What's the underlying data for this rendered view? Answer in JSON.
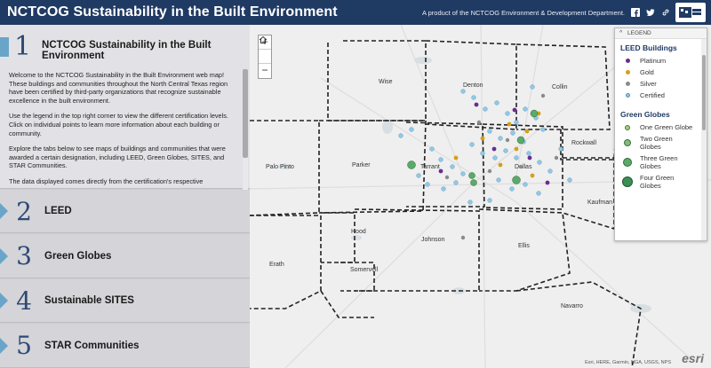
{
  "header": {
    "title": "NCTCOG Sustainability in the Built Environment",
    "product_text": "A product of the NCTCOG Environment & Development Department.",
    "social": [
      "facebook-icon",
      "twitter-icon",
      "link-icon"
    ],
    "bg_color": "#1f3a63"
  },
  "sections": [
    {
      "num": "1",
      "label": "NCTCOG Sustainability in the Built Environment"
    },
    {
      "num": "2",
      "label": "LEED"
    },
    {
      "num": "3",
      "label": "Green Globes"
    },
    {
      "num": "4",
      "label": "Sustainable SITES"
    },
    {
      "num": "5",
      "label": "STAR Communities"
    }
  ],
  "intro": {
    "p1": "Welcome to the NCTCOG Sustainability in the Built Environment web map! These buildings and communities throughout the North Central Texas region have been certified by third-party organizations that recognize sustainable excellence in the built environment.",
    "p2": "Use the legend in the top right corner to view the different certification levels. Click on individual points to learn more information about each building or community.",
    "p3": "Explore the tabs below to see maps of buildings and communities that were awarded a certain designation, including LEED, Green Globes, SITES, and STAR Communities.",
    "p4": "The data displayed comes directly from the certification's respective"
  },
  "map": {
    "zoom_in": "+",
    "zoom_out": "−",
    "counties": [
      "Wise",
      "Denton",
      "Collin",
      "Rockwall",
      "Parker",
      "Tarrant",
      "Dallas",
      "Palo Pinto",
      "Kaufman",
      "Hood",
      "Johnson",
      "Ellis",
      "Somervell",
      "Erath",
      "Navarro"
    ],
    "attribution": "Esri, HERE, Garmin, NGA, USGS, NPS",
    "esri_logo": "esri"
  },
  "legend": {
    "header": "LEGEND",
    "leed_title": "LEED Buildings",
    "leed_items": [
      {
        "label": "Platinum",
        "color": "#6a2c8f"
      },
      {
        "label": "Gold",
        "color": "#d4a017"
      },
      {
        "label": "Silver",
        "color": "#8a8a8a"
      },
      {
        "label": "Certified",
        "color": "#8fc9e8"
      }
    ],
    "gg_title": "Green Globes",
    "gg_items": [
      {
        "label": "One Green Globe",
        "color": "#9fd07a"
      },
      {
        "label": "Two Green Globes",
        "color": "#7ec07a"
      },
      {
        "label": "Three Green Globes",
        "color": "#5aaa6a"
      },
      {
        "label": "Four Green Globes",
        "color": "#3b8f55"
      }
    ]
  }
}
